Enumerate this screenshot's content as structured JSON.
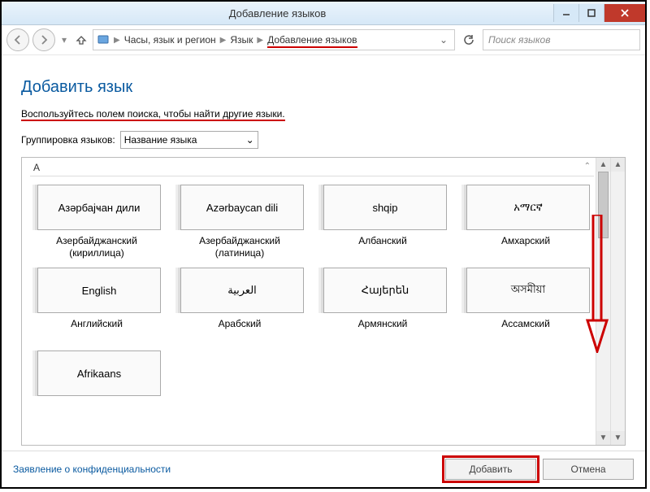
{
  "window": {
    "title": "Добавление языков"
  },
  "breadcrumb": {
    "root": "Часы, язык и регион",
    "mid": "Язык",
    "current": "Добавление языков"
  },
  "search": {
    "placeholder": "Поиск языков"
  },
  "page": {
    "heading": "Добавить язык",
    "hint": "Воспользуйтесь полем поиска, чтобы найти другие языки.",
    "group_label": "Группировка языков:",
    "group_value": "Название языка"
  },
  "section_letter": "A",
  "languages": [
    {
      "native": "Азәрбајҹан дили",
      "label": "Азербайджанский (кириллица)"
    },
    {
      "native": "Azərbaycan dili",
      "label": "Азербайджанский (латиница)"
    },
    {
      "native": "shqip",
      "label": "Албанский"
    },
    {
      "native": "አማርኛ",
      "label": "Амхарский"
    },
    {
      "native": "English",
      "label": "Английский"
    },
    {
      "native": "العربية",
      "label": "Арабский"
    },
    {
      "native": "Հայերեն",
      "label": "Армянский"
    },
    {
      "native": "অসমীয়া",
      "label": "Ассамский"
    },
    {
      "native": "Afrikaans",
      "label": ""
    }
  ],
  "footer": {
    "privacy": "Заявление о конфиденциальности",
    "add": "Добавить",
    "cancel": "Отмена"
  }
}
